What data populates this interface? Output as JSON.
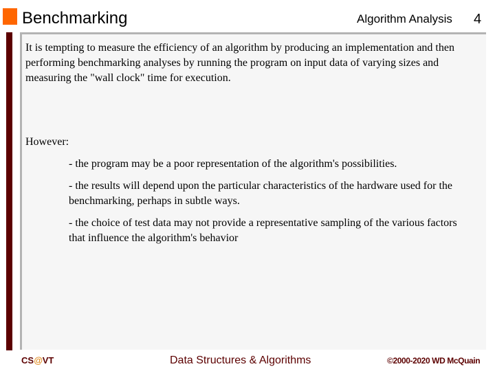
{
  "header": {
    "title": "Benchmarking",
    "topic": "Algorithm Analysis",
    "page_number": "4",
    "accent_color": "#ff6600",
    "bar_color": "#5c0000"
  },
  "content": {
    "intro": "It is tempting to measure the efficiency of an algorithm by producing an implementation and then performing benchmarking analyses by running the program on input data of varying sizes and measuring the \"wall clock\" time for execution.",
    "however_label": "However:",
    "bullets": [
      "- the program may be a poor representation of the algorithm's possibilities.",
      "- the results will depend upon the particular characteristics of the hardware used for the benchmarking, perhaps in subtle ways.",
      "- the choice of test data may not provide a representative sampling of the various factors that influence the algorithm's behavior"
    ]
  },
  "footer": {
    "left_prefix": "CS",
    "left_at": "@",
    "left_suffix": "VT",
    "center": "Data Structures & Algorithms",
    "right": "©2000-2020 WD McQuain"
  }
}
